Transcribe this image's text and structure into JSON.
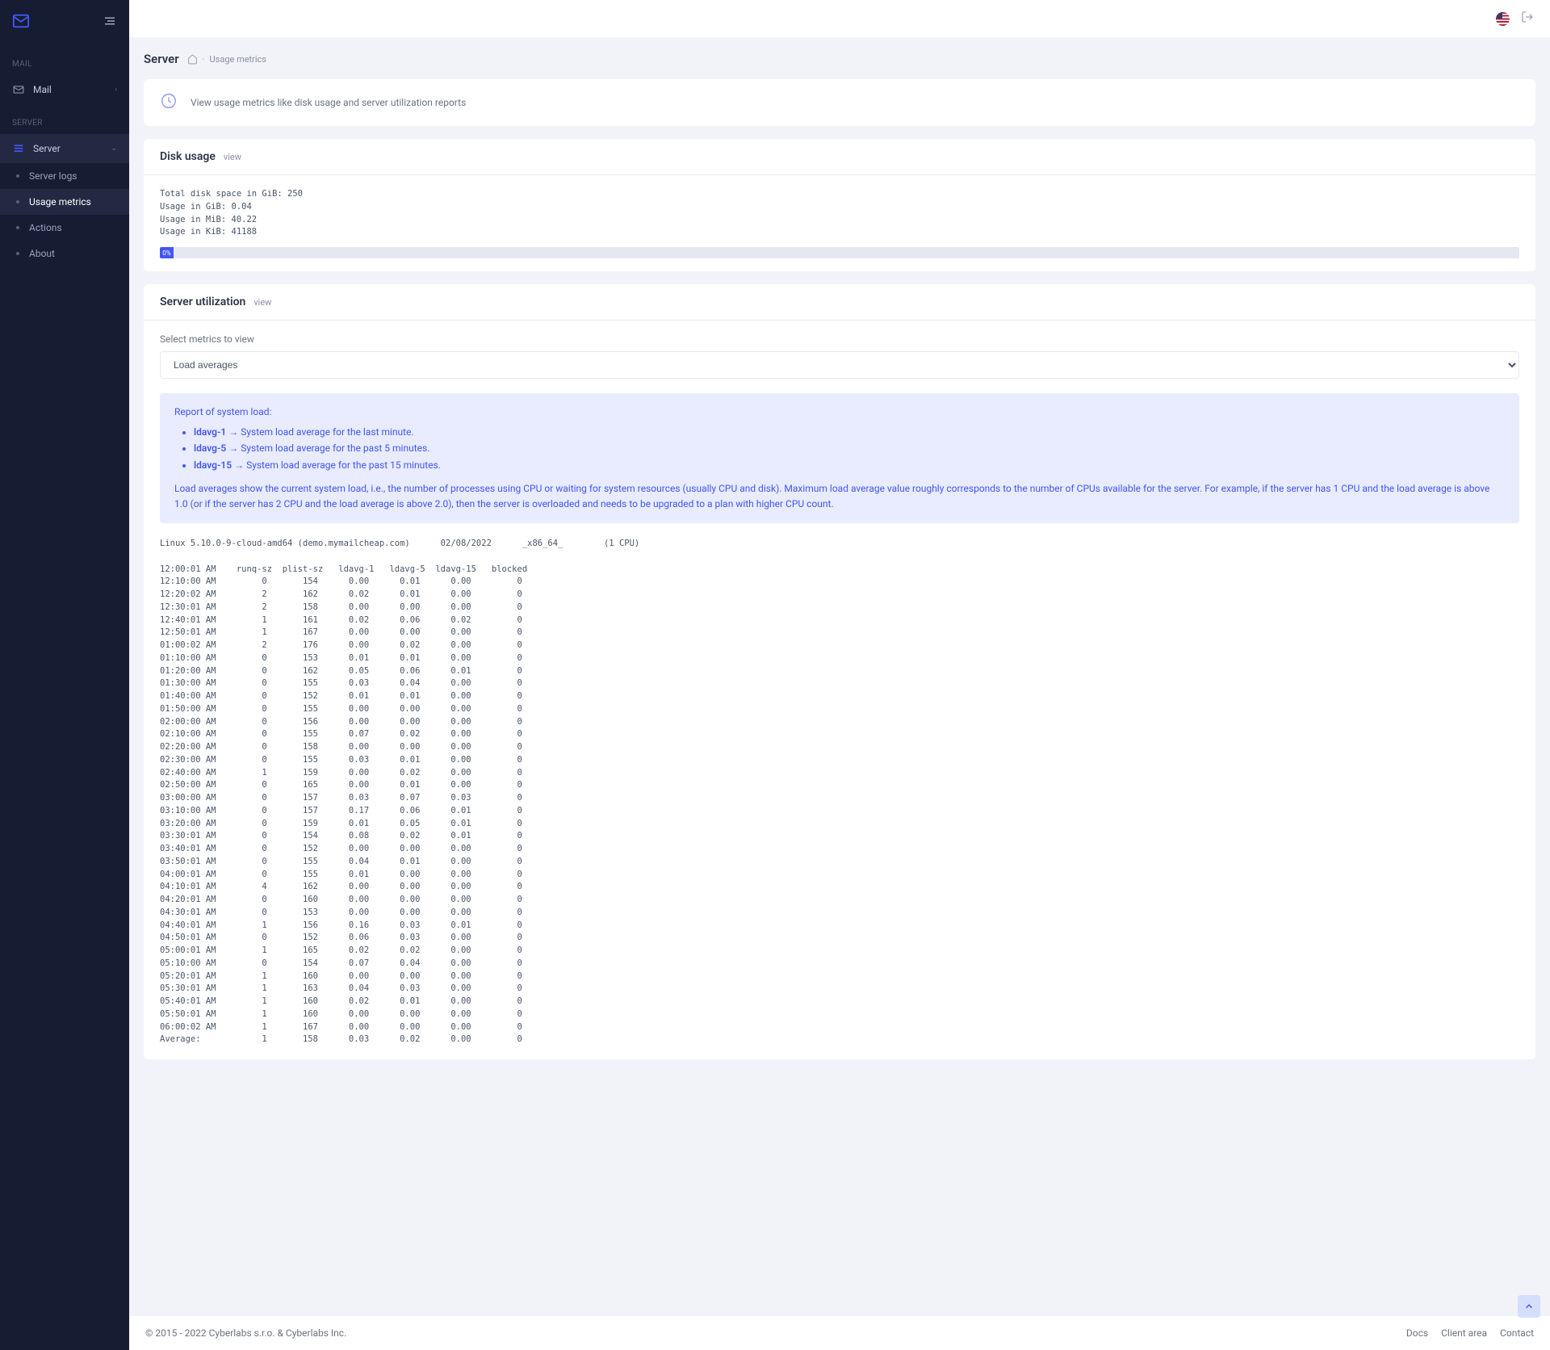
{
  "sidebar": {
    "sections": {
      "mail": {
        "label": "MAIL",
        "items": {
          "mail": "Mail"
        }
      },
      "server": {
        "label": "SERVER",
        "items": {
          "server": "Server",
          "subs": {
            "server_logs": "Server logs",
            "usage_metrics": "Usage metrics",
            "actions": "Actions",
            "about": "About"
          }
        }
      }
    }
  },
  "breadcrumb": {
    "title": "Server",
    "page": "Usage metrics"
  },
  "intro": {
    "text": "View usage metrics like disk usage and server utilization reports"
  },
  "disk": {
    "title": "Disk usage",
    "view": "view",
    "text": "Total disk space in GiB: 250\nUsage in GiB: 0.04\nUsage in MiB: 40.22\nUsage in KiB: 41188",
    "percent_label": "0%",
    "percent_width": "1%"
  },
  "util": {
    "title": "Server utilization",
    "view": "view",
    "select_label": "Select metrics to view",
    "select_value": "Load averages",
    "info": {
      "heading": "Report of system load:",
      "items": [
        {
          "term": "ldavg-1",
          "desc": " → System load average for the last minute."
        },
        {
          "term": "ldavg-5",
          "desc": " → System load average for the past 5 minutes."
        },
        {
          "term": "ldavg-15",
          "desc": " → System load average for the past 15 minutes."
        }
      ],
      "text": "Load averages show the current system load, i.e., the number of processes using CPU or waiting for system resources (usually CPU and disk). Maximum load average value roughly corresponds to the number of CPUs available for the server. For example, if the server has 1 CPU and the load average is above 1.0 (or if the server has 2 CPU and the load average is above 2.0), then the server is overloaded and needs to be upgraded to a plan with higher CPU count."
    },
    "report": "Linux 5.10.0-9-cloud-amd64 (demo.mymailcheap.com)      02/08/2022      _x86_64_        (1 CPU)\n\n12:00:01 AM    runq-sz  plist-sz   ldavg-1   ldavg-5  ldavg-15   blocked\n12:10:00 AM         0       154      0.00      0.01      0.00         0\n12:20:02 AM         2       162      0.02      0.01      0.00         0\n12:30:01 AM         2       158      0.00      0.00      0.00         0\n12:40:01 AM         1       161      0.02      0.06      0.02         0\n12:50:01 AM         1       167      0.00      0.00      0.00         0\n01:00:02 AM         2       176      0.00      0.02      0.00         0\n01:10:00 AM         0       153      0.01      0.01      0.00         0\n01:20:00 AM         0       162      0.05      0.06      0.01         0\n01:30:00 AM         0       155      0.03      0.04      0.00         0\n01:40:00 AM         0       152      0.01      0.01      0.00         0\n01:50:00 AM         0       155      0.00      0.00      0.00         0\n02:00:00 AM         0       156      0.00      0.00      0.00         0\n02:10:00 AM         0       155      0.07      0.02      0.00         0\n02:20:00 AM         0       158      0.00      0.00      0.00         0\n02:30:00 AM         0       155      0.03      0.01      0.00         0\n02:40:00 AM         1       159      0.00      0.02      0.00         0\n02:50:00 AM         0       165      0.00      0.01      0.00         0\n03:00:00 AM         0       157      0.03      0.07      0.03         0\n03:10:00 AM         0       157      0.17      0.06      0.01         0\n03:20:00 AM         0       159      0.01      0.05      0.01         0\n03:30:01 AM         0       154      0.08      0.02      0.01         0\n03:40:01 AM         0       152      0.00      0.00      0.00         0\n03:50:01 AM         0       155      0.04      0.01      0.00         0\n04:00:01 AM         0       155      0.01      0.00      0.00         0\n04:10:01 AM         4       162      0.00      0.00      0.00         0\n04:20:01 AM         0       160      0.00      0.00      0.00         0\n04:30:01 AM         0       153      0.00      0.00      0.00         0\n04:40:01 AM         1       156      0.16      0.03      0.01         0\n04:50:01 AM         0       152      0.06      0.03      0.00         0\n05:00:01 AM         1       165      0.02      0.02      0.00         0\n05:10:00 AM         0       154      0.07      0.04      0.00         0\n05:20:01 AM         1       160      0.00      0.00      0.00         0\n05:30:01 AM         1       163      0.04      0.03      0.00         0\n05:40:01 AM         1       160      0.02      0.01      0.00         0\n05:50:01 AM         1       160      0.00      0.00      0.00         0\n06:00:02 AM         1       167      0.00      0.00      0.00         0\nAverage:            1       158      0.03      0.02      0.00         0"
  },
  "footer": {
    "copyright": "© 2015 - 2022 Cyberlabs s.r.o. & Cyberlabs Inc.",
    "links": {
      "docs": "Docs",
      "client_area": "Client area",
      "contact": "Contact"
    }
  }
}
